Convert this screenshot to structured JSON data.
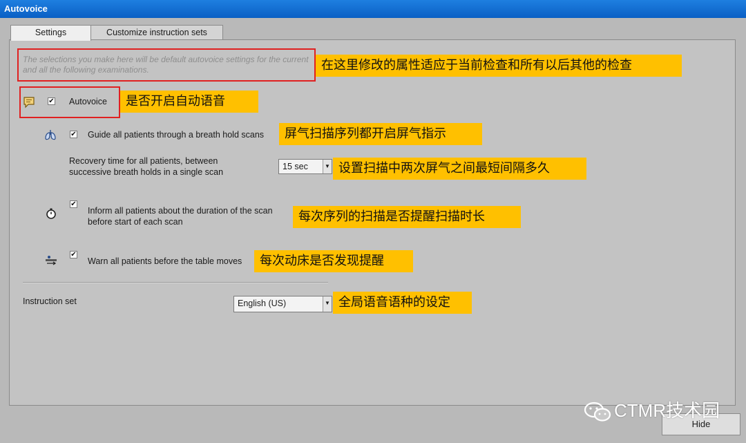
{
  "window": {
    "title": "Autovoice"
  },
  "tabs": [
    {
      "label": "Settings",
      "active": true
    },
    {
      "label": "Customize instruction sets",
      "active": false
    }
  ],
  "hint_text": "The selections you make here will be default autovoice settings for the current and all the following examinations.",
  "autovoice": {
    "label": "Autovoice",
    "checked": true,
    "icon": "speech-bubble-icon"
  },
  "breath_guide": {
    "label": "Guide all patients through a breath hold scans",
    "checked": true,
    "icon": "lungs-icon"
  },
  "recovery": {
    "line1": "Recovery time for all patients, between",
    "line2": "successive breath holds in a single scan",
    "value": "15 sec"
  },
  "inform_duration": {
    "line1": "Inform all patients about the duration of the scan",
    "line2": "before start of each scan",
    "checked": true,
    "icon": "stopwatch-icon"
  },
  "warn_table": {
    "label": "Warn all patients before the table moves",
    "checked": true,
    "icon": "table-move-icon"
  },
  "instruction_set": {
    "label": "Instruction set",
    "value": "English (US)"
  },
  "hide_button": "Hide",
  "annotations": {
    "a1": "在这里修改的属性适应于当前检查和所有以后其他的检查",
    "a2": "是否开启自动语音",
    "a3": "屏气扫描序列都开启屏气指示",
    "a4": "设置扫描中两次屏气之间最短间隔多久",
    "a5": "每次序列的扫描是否提醒扫描时长",
    "a6": "每次动床是否发现提醒",
    "a7": "全局语音语种的设定"
  },
  "watermark": "CTMR技术园",
  "colors": {
    "titlebar": "#0a6fd6",
    "callout": "#ffc000",
    "redbox": "#e02020"
  }
}
